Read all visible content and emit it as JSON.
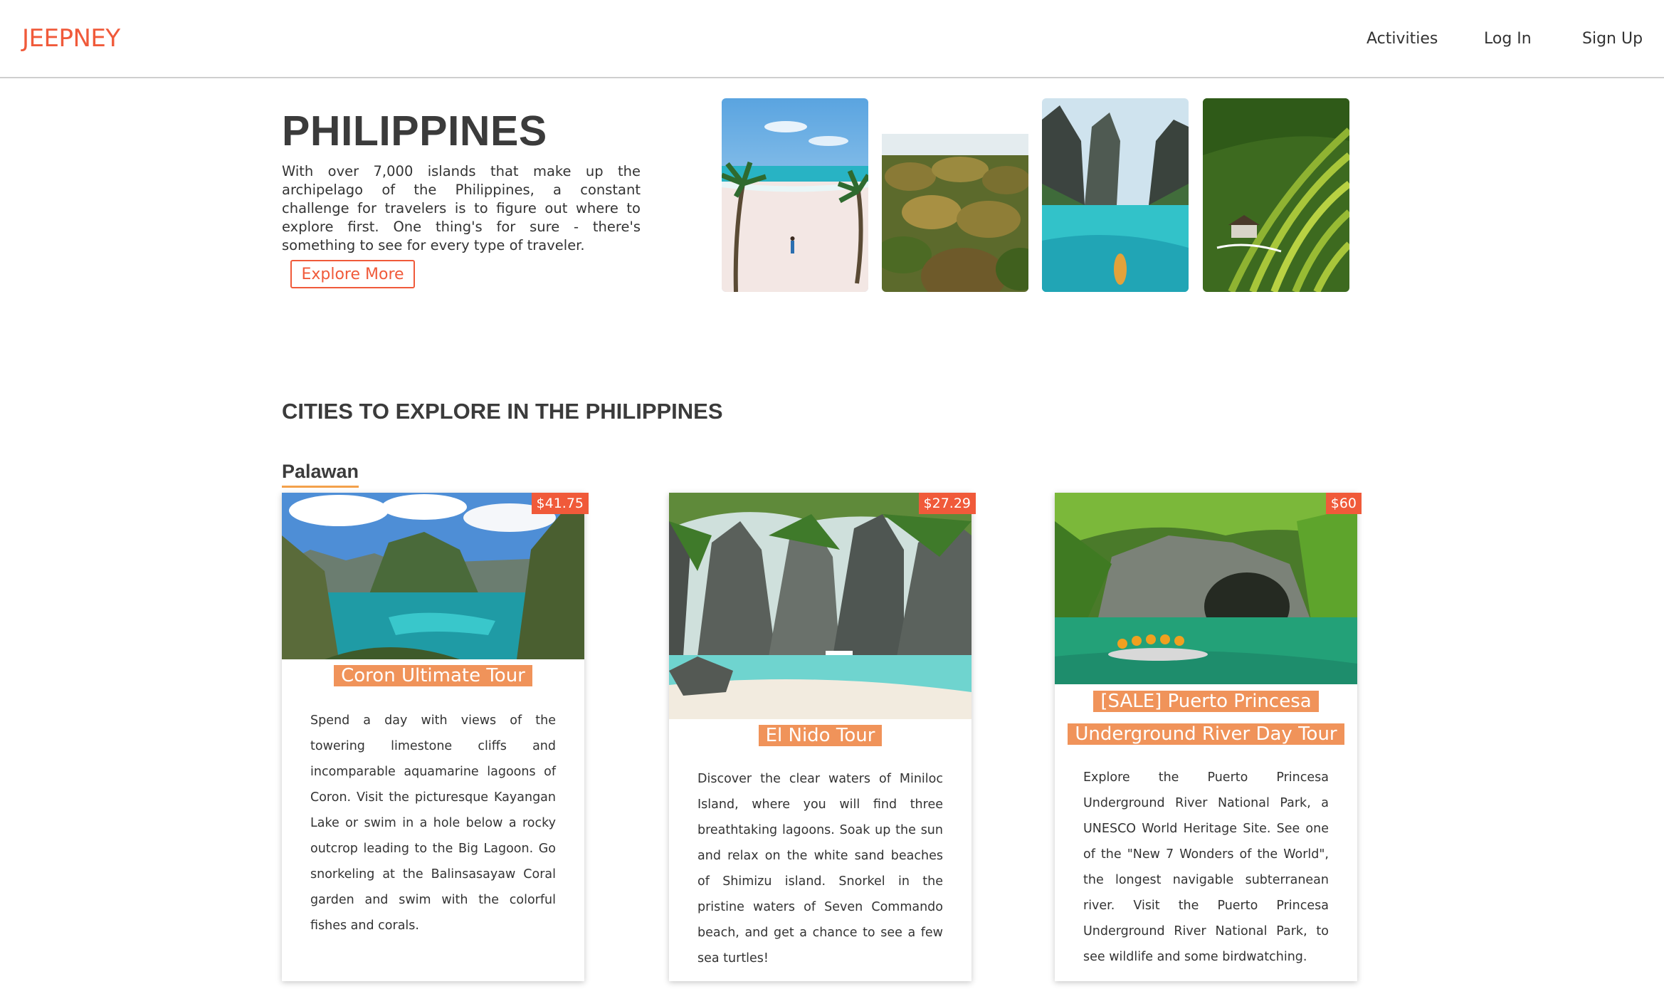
{
  "nav": {
    "logo": "JEEPNEY",
    "links": [
      "Activities",
      "Log In",
      "Sign Up"
    ]
  },
  "hero": {
    "title": "PHILIPPINES",
    "description": "With over 7,000 islands that make up the archipelago of the Philippines, a constant challenge for travelers is to figure out where to explore first. One thing's for sure - there's something to see for every type of traveler.",
    "button": "Explore More"
  },
  "section": {
    "title": "CITIES TO EXPLORE IN THE PHILIPPINES",
    "city": "Palawan"
  },
  "cards": [
    {
      "price": "$41.75",
      "title": "Coron Ultimate Tour",
      "description": "Spend a day with views of the towering limestone cliffs and incomparable aquamarine lagoons of Coron. Visit the picturesque Kayangan Lake or swim in a hole below a rocky outcrop leading to the Big Lagoon. Go snorkeling at the Balinsasayaw Coral garden and swim with the colorful fishes and corals."
    },
    {
      "price": "$27.29",
      "title": "El Nido Tour",
      "description": "Discover the clear waters of Miniloc Island, where you will find three breathtaking lagoons. Soak up the sun and relax on the white sand beaches of Shimizu island. Snorkel in the pristine waters of Seven Commando beach, and get a chance to see a few sea turtles!"
    },
    {
      "price": "$60",
      "title": "[SALE] Puerto Princesa Underground River Day Tour",
      "description": "Explore the Puerto Princesa Underground River National Park, a UNESCO World Heritage Site. See one of the \"New 7 Wonders of the World\", the longest navigable subterranean river. Visit the Puerto Princesa Underground River National Park, to see wildlife and some birdwatching."
    }
  ],
  "colors": {
    "accent": "#f05a3a",
    "title_highlight": "#f0935a",
    "underline": "#f3a14b"
  }
}
